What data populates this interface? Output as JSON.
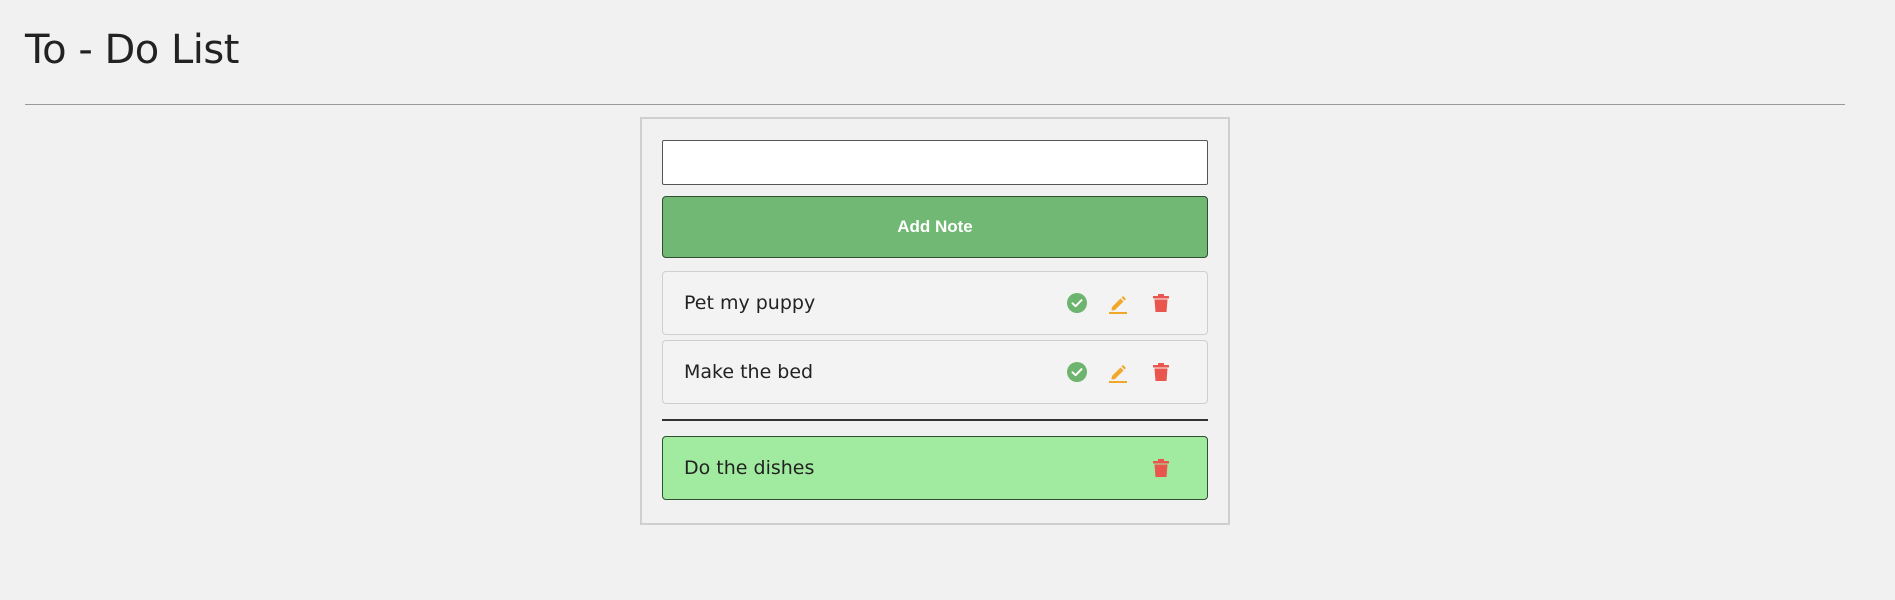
{
  "page": {
    "title": "To - Do List"
  },
  "form": {
    "input_value": "",
    "add_button_label": "Add Note"
  },
  "todos": [
    {
      "text": "Pet my puppy",
      "actions": [
        "check-circle-icon",
        "pencil-icon",
        "trash-icon"
      ]
    },
    {
      "text": "Make the bed",
      "actions": [
        "check-circle-icon",
        "pencil-icon",
        "trash-icon"
      ]
    }
  ],
  "completed": [
    {
      "text": "Do the dishes",
      "actions": [
        "trash-icon"
      ]
    }
  ],
  "colors": {
    "background": "#f1f1f1",
    "add_button": "#71b874",
    "completed_item": "#a1eba0",
    "complete_icon": "#6db46e",
    "edit_icon": "#f0a72a",
    "delete_icon": "#e8564e"
  }
}
